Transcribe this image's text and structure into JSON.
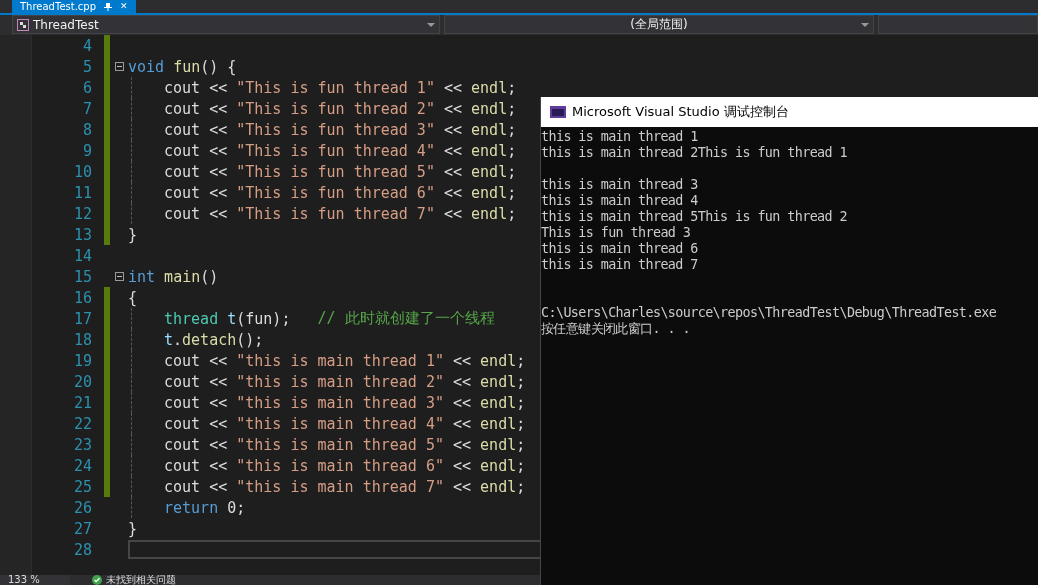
{
  "tab": {
    "title": "ThreadTest.cpp",
    "close": "✕"
  },
  "navigation": {
    "project": "ThreadTest",
    "scope": "(全局范围)"
  },
  "editor": {
    "lines": [
      {
        "number": "4",
        "changed": true,
        "fold": false,
        "guide": false
      },
      {
        "number": "5",
        "changed": true,
        "fold": true,
        "guide": false,
        "tokens": [
          {
            "kind": "keyword",
            "text": "void"
          },
          {
            "kind": "function",
            "text": " fun"
          },
          {
            "kind": "plain",
            "text": "() {"
          }
        ]
      },
      {
        "number": "6",
        "changed": true,
        "fold": false,
        "guide": true,
        "tokens": [
          {
            "kind": "plain",
            "text": "cout << "
          },
          {
            "kind": "string",
            "text": "\"This is fun thread 1\""
          },
          {
            "kind": "plain",
            "text": " << "
          },
          {
            "kind": "function",
            "text": "endl"
          },
          {
            "kind": "plain",
            "text": ";"
          }
        ]
      },
      {
        "number": "7",
        "changed": true,
        "fold": false,
        "guide": true,
        "tokens": [
          {
            "kind": "plain",
            "text": "cout << "
          },
          {
            "kind": "string",
            "text": "\"This is fun thread 2\""
          },
          {
            "kind": "plain",
            "text": " << "
          },
          {
            "kind": "function",
            "text": "endl"
          },
          {
            "kind": "plain",
            "text": ";"
          }
        ]
      },
      {
        "number": "8",
        "changed": true,
        "fold": false,
        "guide": true,
        "tokens": [
          {
            "kind": "plain",
            "text": "cout << "
          },
          {
            "kind": "string",
            "text": "\"This is fun thread 3\""
          },
          {
            "kind": "plain",
            "text": " << "
          },
          {
            "kind": "function",
            "text": "endl"
          },
          {
            "kind": "plain",
            "text": ";"
          }
        ]
      },
      {
        "number": "9",
        "changed": true,
        "fold": false,
        "guide": true,
        "tokens": [
          {
            "kind": "plain",
            "text": "cout << "
          },
          {
            "kind": "string",
            "text": "\"This is fun thread 4\""
          },
          {
            "kind": "plain",
            "text": " << "
          },
          {
            "kind": "function",
            "text": "endl"
          },
          {
            "kind": "plain",
            "text": ";"
          }
        ]
      },
      {
        "number": "10",
        "changed": true,
        "fold": false,
        "guide": true,
        "tokens": [
          {
            "kind": "plain",
            "text": "cout << "
          },
          {
            "kind": "string",
            "text": "\"This is fun thread 5\""
          },
          {
            "kind": "plain",
            "text": " << "
          },
          {
            "kind": "function",
            "text": "endl"
          },
          {
            "kind": "plain",
            "text": ";"
          }
        ]
      },
      {
        "number": "11",
        "changed": true,
        "fold": false,
        "guide": true,
        "tokens": [
          {
            "kind": "plain",
            "text": "cout << "
          },
          {
            "kind": "string",
            "text": "\"This is fun thread 6\""
          },
          {
            "kind": "plain",
            "text": " << "
          },
          {
            "kind": "function",
            "text": "endl"
          },
          {
            "kind": "plain",
            "text": ";"
          }
        ]
      },
      {
        "number": "12",
        "changed": true,
        "fold": false,
        "guide": true,
        "tokens": [
          {
            "kind": "plain",
            "text": "cout << "
          },
          {
            "kind": "string",
            "text": "\"This is fun thread 7\""
          },
          {
            "kind": "plain",
            "text": " << "
          },
          {
            "kind": "function",
            "text": "endl"
          },
          {
            "kind": "plain",
            "text": ";"
          }
        ]
      },
      {
        "number": "13",
        "changed": true,
        "fold": false,
        "guide": false,
        "tokens": [
          {
            "kind": "plain",
            "text": "}"
          }
        ]
      },
      {
        "number": "14",
        "changed": false,
        "fold": false,
        "guide": false
      },
      {
        "number": "15",
        "changed": false,
        "fold": true,
        "guide": false,
        "tokens": [
          {
            "kind": "keyword",
            "text": "int"
          },
          {
            "kind": "function",
            "text": " main"
          },
          {
            "kind": "plain",
            "text": "()"
          }
        ]
      },
      {
        "number": "16",
        "changed": true,
        "fold": false,
        "guide": false,
        "tokens": [
          {
            "kind": "plain",
            "text": "{"
          }
        ]
      },
      {
        "number": "17",
        "changed": true,
        "fold": false,
        "guide": true,
        "tokens": [
          {
            "kind": "type",
            "text": "thread"
          },
          {
            "kind": "variable",
            "text": " t"
          },
          {
            "kind": "plain",
            "text": "(fun);"
          },
          {
            "kind": "comment",
            "text": "   // 此时就创建了一个线程"
          }
        ]
      },
      {
        "number": "18",
        "changed": true,
        "fold": false,
        "guide": true,
        "tokens": [
          {
            "kind": "variable",
            "text": "t"
          },
          {
            "kind": "plain",
            "text": "."
          },
          {
            "kind": "function",
            "text": "detach"
          },
          {
            "kind": "plain",
            "text": "();"
          }
        ]
      },
      {
        "number": "19",
        "changed": true,
        "fold": false,
        "guide": true,
        "tokens": [
          {
            "kind": "plain",
            "text": "cout << "
          },
          {
            "kind": "string",
            "text": "\"this is main thread 1\""
          },
          {
            "kind": "plain",
            "text": " << "
          },
          {
            "kind": "function",
            "text": "endl"
          },
          {
            "kind": "plain",
            "text": ";"
          }
        ]
      },
      {
        "number": "20",
        "changed": true,
        "fold": false,
        "guide": true,
        "tokens": [
          {
            "kind": "plain",
            "text": "cout << "
          },
          {
            "kind": "string",
            "text": "\"this is main thread 2\""
          },
          {
            "kind": "plain",
            "text": " << "
          },
          {
            "kind": "function",
            "text": "endl"
          },
          {
            "kind": "plain",
            "text": ";"
          }
        ]
      },
      {
        "number": "21",
        "changed": true,
        "fold": false,
        "guide": true,
        "tokens": [
          {
            "kind": "plain",
            "text": "cout << "
          },
          {
            "kind": "string",
            "text": "\"this is main thread 3\""
          },
          {
            "kind": "plain",
            "text": " << "
          },
          {
            "kind": "function",
            "text": "endl"
          },
          {
            "kind": "plain",
            "text": ";"
          }
        ]
      },
      {
        "number": "22",
        "changed": true,
        "fold": false,
        "guide": true,
        "tokens": [
          {
            "kind": "plain",
            "text": "cout << "
          },
          {
            "kind": "string",
            "text": "\"this is main thread 4\""
          },
          {
            "kind": "plain",
            "text": " << "
          },
          {
            "kind": "function",
            "text": "endl"
          },
          {
            "kind": "plain",
            "text": ";"
          }
        ]
      },
      {
        "number": "23",
        "changed": true,
        "fold": false,
        "guide": true,
        "tokens": [
          {
            "kind": "plain",
            "text": "cout << "
          },
          {
            "kind": "string",
            "text": "\"this is main thread 5\""
          },
          {
            "kind": "plain",
            "text": " << "
          },
          {
            "kind": "function",
            "text": "endl"
          },
          {
            "kind": "plain",
            "text": ";"
          }
        ]
      },
      {
        "number": "24",
        "changed": true,
        "fold": false,
        "guide": true,
        "tokens": [
          {
            "kind": "plain",
            "text": "cout << "
          },
          {
            "kind": "string",
            "text": "\"this is main thread 6\""
          },
          {
            "kind": "plain",
            "text": " << "
          },
          {
            "kind": "function",
            "text": "endl"
          },
          {
            "kind": "plain",
            "text": ";"
          }
        ]
      },
      {
        "number": "25",
        "changed": true,
        "fold": false,
        "guide": true,
        "tokens": [
          {
            "kind": "plain",
            "text": "cout << "
          },
          {
            "kind": "string",
            "text": "\"this is main thread 7\""
          },
          {
            "kind": "plain",
            "text": " << "
          },
          {
            "kind": "function",
            "text": "endl"
          },
          {
            "kind": "plain",
            "text": ";"
          }
        ]
      },
      {
        "number": "26",
        "changed": false,
        "fold": false,
        "guide": true,
        "tokens": [
          {
            "kind": "keyword",
            "text": "return"
          },
          {
            "kind": "plain",
            "text": " 0;"
          }
        ]
      },
      {
        "number": "27",
        "changed": false,
        "fold": false,
        "guide": false,
        "tokens": [
          {
            "kind": "plain",
            "text": "}"
          }
        ]
      },
      {
        "number": "28",
        "changed": false,
        "fold": false,
        "guide": false,
        "current": true
      }
    ]
  },
  "status_bar": {
    "zoom": "133 %",
    "issues": "未找到相关问题"
  },
  "console": {
    "title": "Microsoft Visual Studio 调试控制台",
    "lines": [
      {
        "kind": "text",
        "text": "this is main thread 1"
      },
      {
        "kind": "text",
        "text": "this is main thread 2This is fun thread 1"
      },
      {
        "kind": "blank"
      },
      {
        "kind": "text",
        "text": "this is main thread 3"
      },
      {
        "kind": "text",
        "text": "this is main thread 4"
      },
      {
        "kind": "text",
        "text": "this is main thread 5This is fun thread 2"
      },
      {
        "kind": "text",
        "text": "This is fun thread 3"
      },
      {
        "kind": "text",
        "text": "this is main thread 6"
      },
      {
        "kind": "text",
        "text": "this is main thread 7"
      },
      {
        "kind": "blank"
      },
      {
        "kind": "blank"
      },
      {
        "kind": "text",
        "text": "C:\\Users\\Charles\\source\\repos\\ThreadTest\\Debug\\ThreadTest.exe"
      },
      {
        "kind": "text",
        "text": "按任意键关闭此窗口. . ."
      }
    ]
  }
}
